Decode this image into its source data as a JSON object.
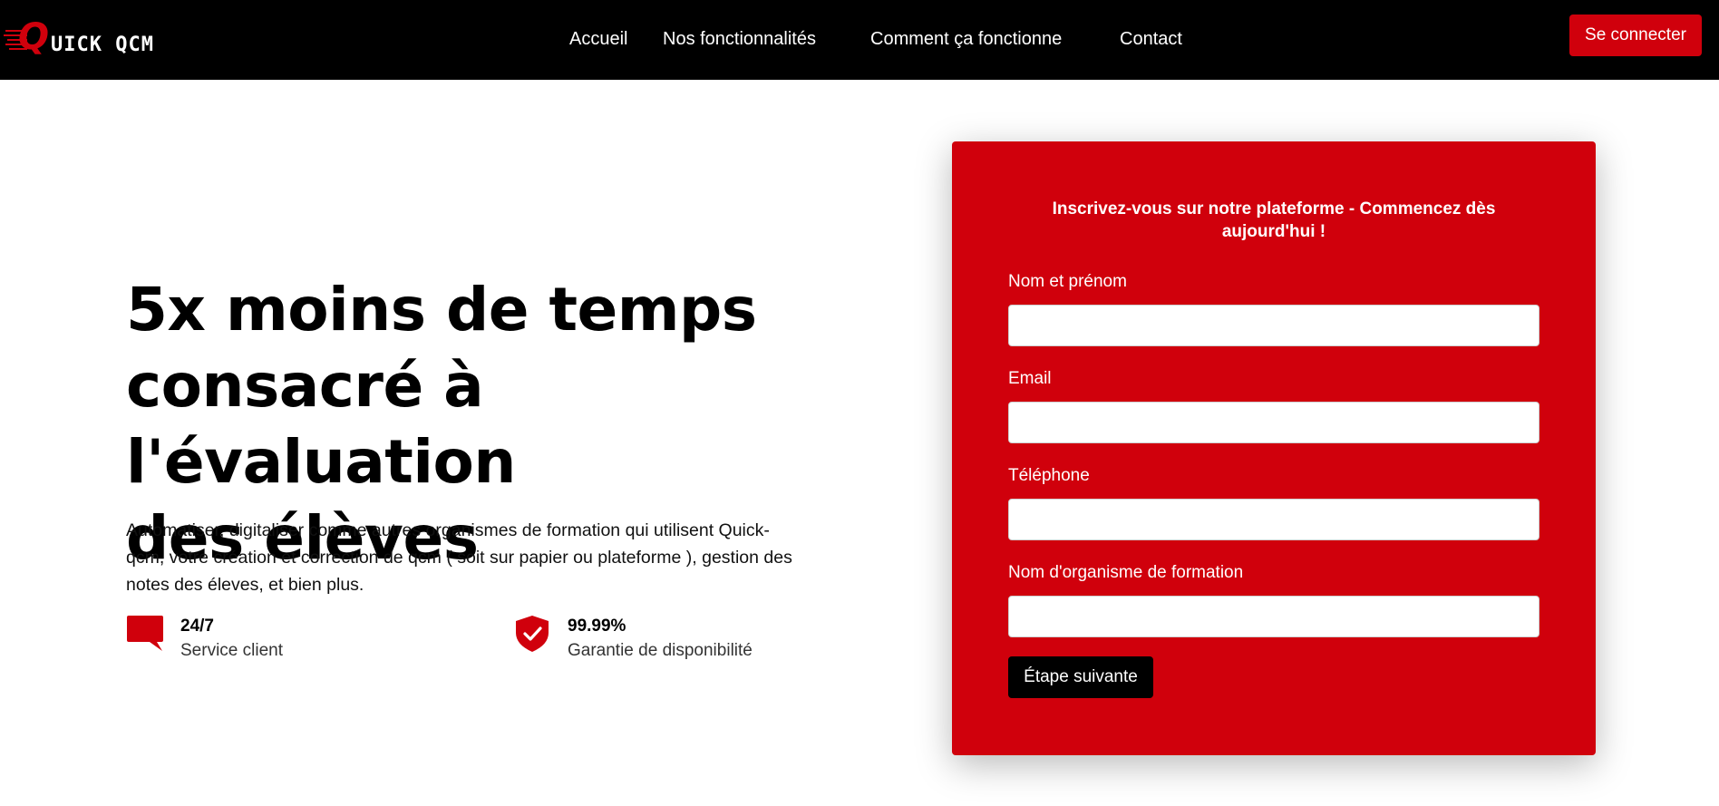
{
  "brand": {
    "logo_initial": "Q",
    "logo_rest": "UICK QCM",
    "accent_color": "#d0000c"
  },
  "nav": {
    "items": [
      {
        "label": "Accueil"
      },
      {
        "label": "Nos fonctionnalités"
      },
      {
        "label": "Comment ça fonctionne"
      },
      {
        "label": "Contact"
      }
    ],
    "login_label": "Se connecter"
  },
  "hero": {
    "title_line1": "5x moins de temps",
    "title_line2": "consacré à l'évaluation",
    "title_line3": "des élèves",
    "description": "Automatiser, digitaliser comme autres organismes de formation qui utilisent Quick-qcm, votre création et correction de qcm ( soit sur papier ou plateforme ), gestion des notes des éleves, et bien plus.",
    "features": [
      {
        "icon": "chat-bubble-icon",
        "value": "24/7",
        "label": "Service client"
      },
      {
        "icon": "shield-check-icon",
        "value": "99.99%",
        "label": "Garantie de disponibilité"
      }
    ]
  },
  "signup_form": {
    "heading": "Inscrivez-vous sur notre plateforme - Commencez dès aujourd'hui !",
    "fields": [
      {
        "label": "Nom et prénom",
        "value": ""
      },
      {
        "label": "Email",
        "value": ""
      },
      {
        "label": "Téléphone",
        "value": ""
      },
      {
        "label": "Nom d'organisme de formation",
        "value": ""
      }
    ],
    "submit_label": "Étape suivante"
  }
}
